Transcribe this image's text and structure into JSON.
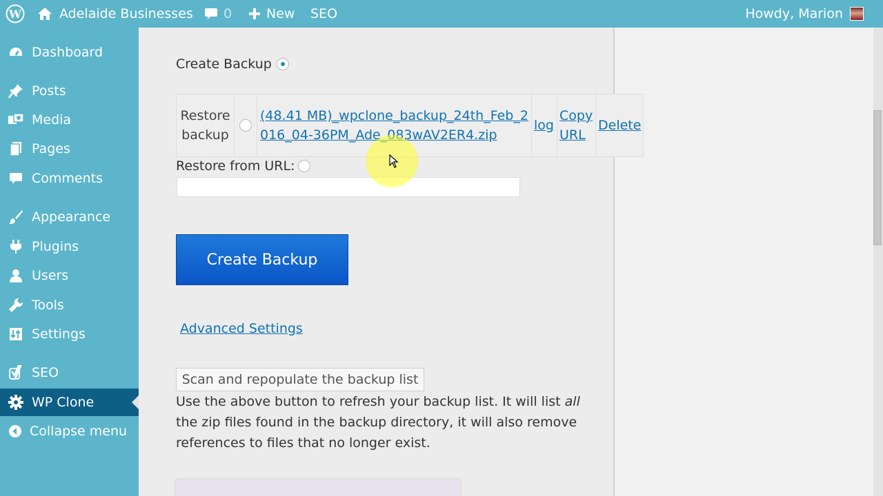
{
  "admin_bar": {
    "site_name": "Adelaide Businesses",
    "comment_count": "0",
    "new_label": "New",
    "seo_label": "SEO",
    "howdy": "Howdy, Marion"
  },
  "sidebar": {
    "items": [
      {
        "label": "Dashboard",
        "icon": "dashboard-icon"
      },
      {
        "label": "Posts",
        "icon": "pin-icon"
      },
      {
        "label": "Media",
        "icon": "media-icon"
      },
      {
        "label": "Pages",
        "icon": "pages-icon"
      },
      {
        "label": "Comments",
        "icon": "comment-icon"
      },
      {
        "label": "Appearance",
        "icon": "brush-icon"
      },
      {
        "label": "Plugins",
        "icon": "plug-icon"
      },
      {
        "label": "Users",
        "icon": "user-icon"
      },
      {
        "label": "Tools",
        "icon": "wrench-icon"
      },
      {
        "label": "Settings",
        "icon": "settings-icon"
      },
      {
        "label": "SEO",
        "icon": "yoast-icon"
      },
      {
        "label": "WP Clone",
        "icon": "gear-icon",
        "current": true
      },
      {
        "label": "Collapse menu",
        "icon": "collapse-icon"
      }
    ]
  },
  "main": {
    "create_backup_label": "Create Backup",
    "restore_backup_label": "Restore backup",
    "backup_file": "(48.41 MB)_wpclone_backup_24th_Feb_2016_04-36PM_Ade_083wAV2ER4.zip",
    "log_link": "log",
    "copy_url_link": "Copy URL",
    "delete_link": "Delete",
    "restore_from_url_label": "Restore from URL:",
    "url_value": "",
    "create_backup_button": "Create Backup",
    "advanced_settings_link": "Advanced Settings",
    "scan_button": "Scan and repopulate the backup list",
    "help_before": "Use the above button to refresh your backup list. It will list ",
    "help_em": "all",
    "help_after": " the zip files found in the backup directory, it will also remove references to files that no longer exist."
  },
  "colors": {
    "sidebar_bg": "#5cb5cb",
    "current_item_bg": "#0e5f86",
    "button_blue": "#0a55c8",
    "link": "#0f72b4"
  }
}
